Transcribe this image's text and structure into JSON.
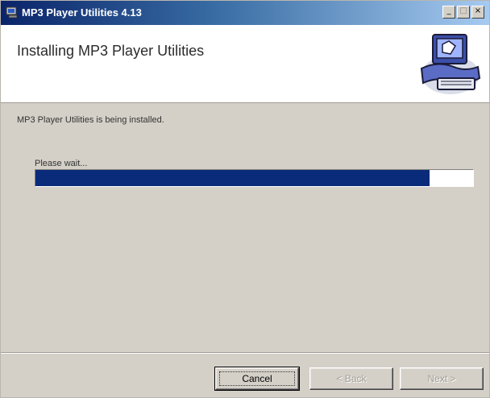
{
  "window": {
    "title": "MP3 Player Utilities 4.13",
    "title_icon": "installer-icon",
    "controls": [
      "minimize-icon",
      "maximize-icon",
      "close-icon"
    ]
  },
  "header": {
    "title": "Installing MP3 Player Utilities",
    "art_icon": "computer-installer-icon"
  },
  "body": {
    "status_text": "MP3 Player Utilities is being installed.",
    "wait_label": "Please wait...",
    "progress_percent": 90
  },
  "buttons": {
    "cancel": "Cancel",
    "back": "< Back",
    "next": "Next >"
  },
  "colors": {
    "titlebar_start": "#0a246a",
    "progress_fill": "#0a2a7a",
    "dialog_face": "#d4d0c8"
  }
}
